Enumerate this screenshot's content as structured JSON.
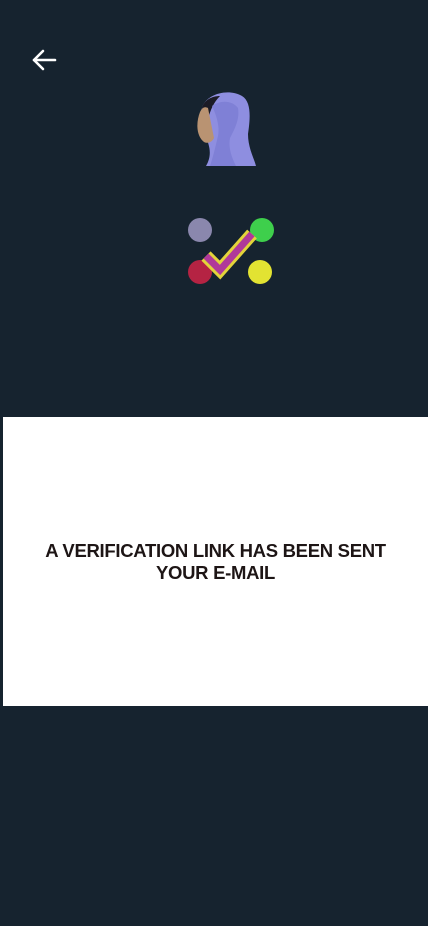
{
  "header": {
    "back_icon": "arrow-left-icon"
  },
  "illustration": {
    "avatar_icon": "hijab-woman-avatar-icon",
    "logo_icon": "checkmark-dots-logo-icon"
  },
  "message": {
    "text": "A  VERIFICATION LINK HAS BEEN SENT\nYOUR E-MAIL"
  },
  "colors": {
    "background": "#16232f",
    "card": "#ffffff",
    "text": "#1d1515",
    "dot_purple": "#8a87ad",
    "dot_green": "#3ecf4c",
    "dot_red": "#b52343",
    "dot_yellow": "#e2e332",
    "check_fill": "#b0389a",
    "check_outline": "#e3d43a",
    "hijab": "#8e8ee0",
    "skin": "#b99372"
  }
}
